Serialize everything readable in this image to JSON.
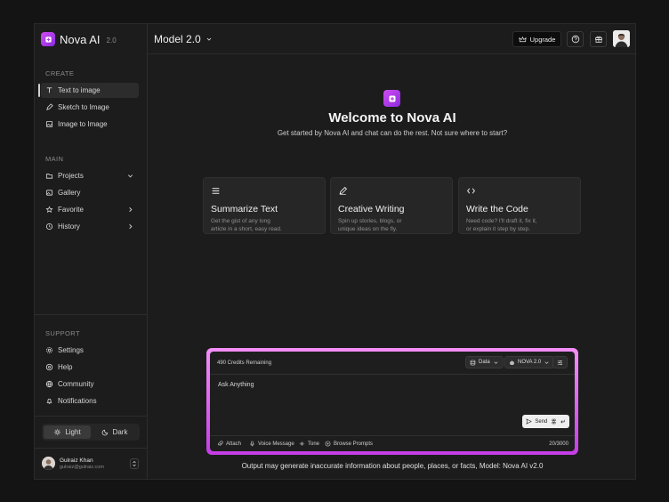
{
  "brand": {
    "name": "Nova AI",
    "version": "2.0"
  },
  "sidebar": {
    "create_title": "CREATE",
    "create_items": [
      {
        "label": "Text to image",
        "icon": "text-icon",
        "active": true
      },
      {
        "label": "Sketch to Image",
        "icon": "pencil-icon"
      },
      {
        "label": "Image to Image",
        "icon": "image-icon"
      }
    ],
    "main_title": "MAIN",
    "main_items": [
      {
        "label": "Projects",
        "icon": "folder-icon",
        "chevron": "down"
      },
      {
        "label": "Gallery",
        "icon": "gallery-icon"
      },
      {
        "label": "Favorite",
        "icon": "star-icon",
        "chevron": "right"
      },
      {
        "label": "History",
        "icon": "history-icon",
        "chevron": "right"
      }
    ],
    "support_title": "SUPPORT",
    "support_items": [
      {
        "label": "Settings",
        "icon": "gear-icon"
      },
      {
        "label": "Help",
        "icon": "help-icon"
      },
      {
        "label": "Community",
        "icon": "globe-icon"
      },
      {
        "label": "Notifications",
        "icon": "bell-icon"
      }
    ],
    "theme": {
      "light": "Light",
      "dark": "Dark",
      "selected": "Light"
    },
    "user": {
      "name": "Gulraiz Khan",
      "email": "gulraiz@gulraiz.com"
    }
  },
  "header": {
    "model": "Model 2.0",
    "upgrade": "Upgrade"
  },
  "hero": {
    "title": "Welcome to Nova AI",
    "subtitle": "Get started by Nova AI and chat can do the rest. Not sure where to start?"
  },
  "cards": [
    {
      "icon": "menu-icon",
      "title": "Summarize Text",
      "desc1": "Get the gist of any long",
      "desc2": "article in a short, easy read."
    },
    {
      "icon": "pen-icon",
      "title": "Creative Writing",
      "desc1": "Spin up stories, blogs, or",
      "desc2": "unique ideas on the fly."
    },
    {
      "icon": "code-icon",
      "title": "Write the Code",
      "desc1": "Need code? I'll draft it, fix it,",
      "desc2": "or explain it step by step."
    }
  ],
  "composer": {
    "credits": "490 Credits Remaining",
    "data_label": "Data",
    "model_label": "NOVA 2.0",
    "prompt": "Ask Anything",
    "send": "Send",
    "tools": {
      "attach": "Attach",
      "voice": "Voice Message",
      "tone": "Tone",
      "browse": "Browse Prompts"
    },
    "count": "20/3000"
  },
  "disclaimer": "Output may generate inaccurate information about people, places, or facts, Model: Nova AI v2.0",
  "colors": {
    "accent_start": "#f58ff7",
    "accent_end": "#c43de6",
    "background": "#1c1c1c"
  }
}
